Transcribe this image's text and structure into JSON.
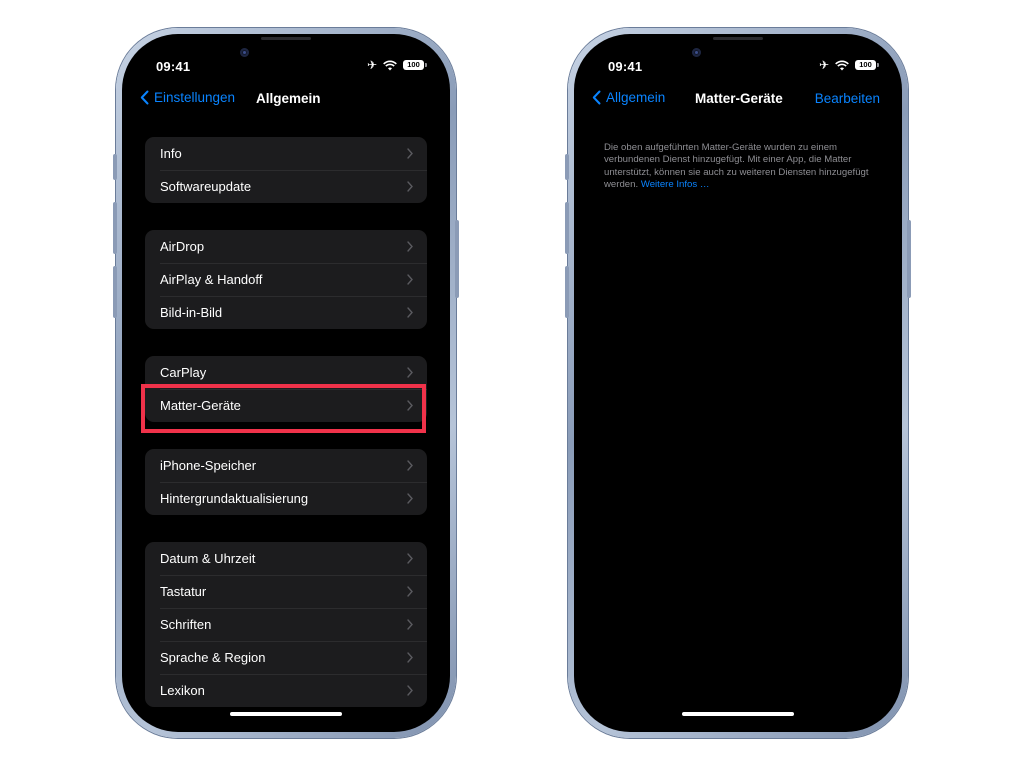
{
  "left_phone": {
    "status_bar": {
      "time": "09:41",
      "airplane_icon": "airplane-icon",
      "wifi_icon": "wifi-icon",
      "battery": "100"
    },
    "nav": {
      "back_label": "Einstellungen",
      "title": "Allgemein"
    },
    "groups": [
      {
        "items": [
          {
            "label": "Info"
          },
          {
            "label": "Softwareupdate"
          }
        ]
      },
      {
        "items": [
          {
            "label": "AirDrop"
          },
          {
            "label": "AirPlay & Handoff"
          },
          {
            "label": "Bild-in-Bild"
          }
        ]
      },
      {
        "items": [
          {
            "label": "CarPlay"
          },
          {
            "label": "Matter-Geräte",
            "highlighted": true
          }
        ]
      },
      {
        "items": [
          {
            "label": "iPhone-Speicher"
          },
          {
            "label": "Hintergrundaktualisierung"
          }
        ]
      },
      {
        "items": [
          {
            "label": "Datum & Uhrzeit"
          },
          {
            "label": "Tastatur"
          },
          {
            "label": "Schriften"
          },
          {
            "label": "Sprache & Region"
          },
          {
            "label": "Lexikon"
          }
        ]
      }
    ],
    "highlight_color": "#f0324a"
  },
  "right_phone": {
    "status_bar": {
      "time": "09:41",
      "airplane_icon": "airplane-icon",
      "wifi_icon": "wifi-icon",
      "battery": "100"
    },
    "nav": {
      "back_label": "Allgemein",
      "title": "Matter-Geräte",
      "action_label": "Bearbeiten"
    },
    "footer": {
      "text": "Die oben aufgeführten Matter-Geräte wurden zu einem verbundenen Dienst hinzugefügt. Mit einer App, die Matter unterstützt, können sie auch zu weiteren Diensten hinzugefügt werden.",
      "link": "Weitere Infos …"
    }
  },
  "colors": {
    "accent": "#0a84ff",
    "background": "#000000",
    "cell": "#1c1c1e",
    "secondary_text": "#8e8e93"
  }
}
